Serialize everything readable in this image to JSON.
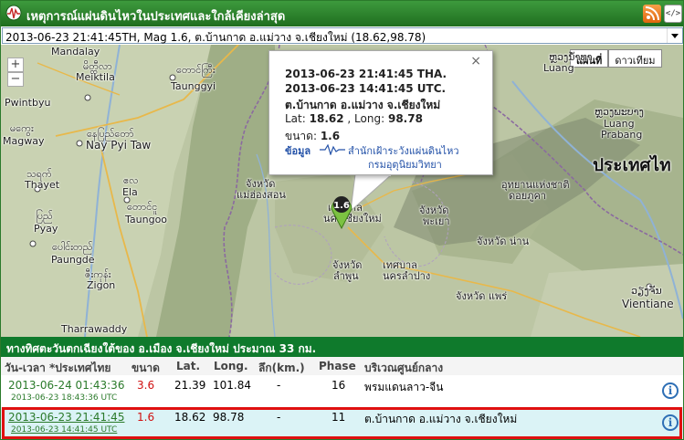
{
  "header": {
    "title": "เหตุการณ์แผ่นดินไหวในประเทศและใกล้เคียงล่าสุด",
    "embed_label": "</>"
  },
  "selector": {
    "selected": "2013-06-23 21:41:45TH, Mag 1.6, ต.บ้านกาด อ.แม่วาง จ.เชียงใหม่ (18.62,98.78)"
  },
  "map": {
    "zoom_in": "+",
    "zoom_out": "−",
    "type_buttons": [
      "แผนที่",
      "ดาวเทียม"
    ],
    "labels": {
      "mandalay": "Mandalay",
      "meiktila_mm": "မိတ္ထီလာ",
      "meiktila": "Meiktila",
      "taunggyi_mm": "တောင်ကြီး",
      "taunggyi": "Taunggyi",
      "pwintbyu": "Pwintbyu",
      "magway_mm": "မကွေး",
      "magway": "Magway",
      "naypyitaw_mm": "နေပြည်တော်",
      "naypyitaw": "Nay Pyi Taw",
      "thayet_mm": "သရက်",
      "thayet": "Thayet",
      "ela_mm": "ဧလ",
      "ela": "Ela",
      "taungoo_mm": "တောင်ငူ",
      "taungoo": "Taungoo",
      "pyay_mm": "ပြည်",
      "pyay": "Pyay",
      "paungde_mm": "ပေါင်းတည်",
      "paungde": "Paungde",
      "zigon_mm": "ဇီးကုန်း",
      "zigon": "Zigon",
      "tharrawaddy": "Tharrawaddy",
      "luang_namtha_la": "ຫຼວງນ້ຳທາ",
      "luang": "Luang",
      "luang_prabang_la": "ຫຼວງພະບາງ",
      "luang2": "Luang",
      "prabang": "Prabang",
      "thailand": "ประเทศไท",
      "maehongson_1": "จังหวัด",
      "maehongson_2": "แม่ฮ่องสอน",
      "chiangmai_1": "เทศบาล",
      "chiangmai_2": "นครเชียงใหม่",
      "phayao_1": "จังหวัด",
      "phayao_2": "พะเยา",
      "lamphun_1": "จังหวัด",
      "lamphun_2": "ลำพูน",
      "lampang_1": "เทศบาล",
      "lampang_2": "นครลำปาง",
      "nan": "จังหวัด น่าน",
      "phrae": "จังหวัด แพร่",
      "nationalpark_1": "อุทยานแห่งชาติ",
      "nationalpark_2": "ดอยภูคา",
      "vientiane_la": "ວຽງຈັນ",
      "vientiane": "Vientiane"
    },
    "marker_label": "1.6"
  },
  "bubble": {
    "close": "×",
    "time_th": "2013-06-23 21:41:45 THA.",
    "time_utc": "2013-06-23 14:41:45 UTC.",
    "place": "ต.บ้านกาด อ.แม่วาง จ.เชียงใหม่",
    "lat_label": "Lat:",
    "lat": "18.62",
    "long_label": ", Long:",
    "long": "98.78",
    "mag_label": "ขนาด:",
    "mag": "1.6",
    "source_label": "ข้อมูล",
    "org_line1": "สำนักเฝ้าระวังแผ่นดินไหว",
    "org_line2": "กรมอุตุนิยมวิทยา"
  },
  "band": {
    "text": "ทางทิศตะวันตกเฉียงใต้ของ อ.เมือง จ.เชียงใหม่ ประมาณ 33 กม."
  },
  "table": {
    "headers": [
      "วัน-เวลา *ประเทศไทย",
      "ขนาด",
      "Lat.",
      "Long.",
      "ลึก(km.)",
      "Phase",
      "บริเวณศูนย์กลาง"
    ],
    "rows": [
      {
        "datetime": "2013-06-24 01:43:36",
        "utc": "2013-06-23 18:43:36 UTC",
        "mag": "3.6",
        "lat": "21.39",
        "long": "101.84",
        "depth": "-",
        "phase": "16",
        "area": "พรมแดนลาว-จีน"
      },
      {
        "datetime": "2013-06-23 21:41:45",
        "utc": "2013-06-23 14:41:45 UTC",
        "mag": "1.6",
        "lat": "18.62",
        "long": "98.78",
        "depth": "-",
        "phase": "11",
        "area": "ต.บ้านกาด อ.แม่วาง จ.เชียงใหม่"
      }
    ]
  },
  "colors": {
    "header_green": "#2b8a2b",
    "band_green": "#0f7a2c",
    "magnitude_red": "#d01010",
    "selection_red": "#e01010",
    "selected_row": "#dbf3f6"
  }
}
